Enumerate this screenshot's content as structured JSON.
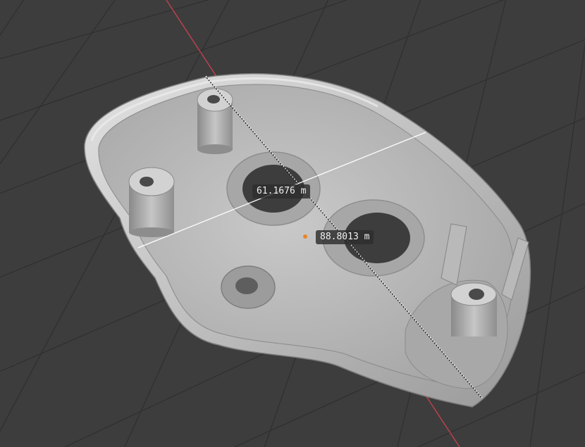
{
  "viewport": {
    "background_color": "#3d3d3d",
    "grid_color": "#2f2f2f",
    "axis_y_color": "#b8414e",
    "model_color": "#bdbdbd"
  },
  "measurements": [
    {
      "name": "width",
      "label": "61.1676 m"
    },
    {
      "name": "length",
      "label": "88.8013 m"
    }
  ],
  "origin_marker_color": "#e8852a"
}
